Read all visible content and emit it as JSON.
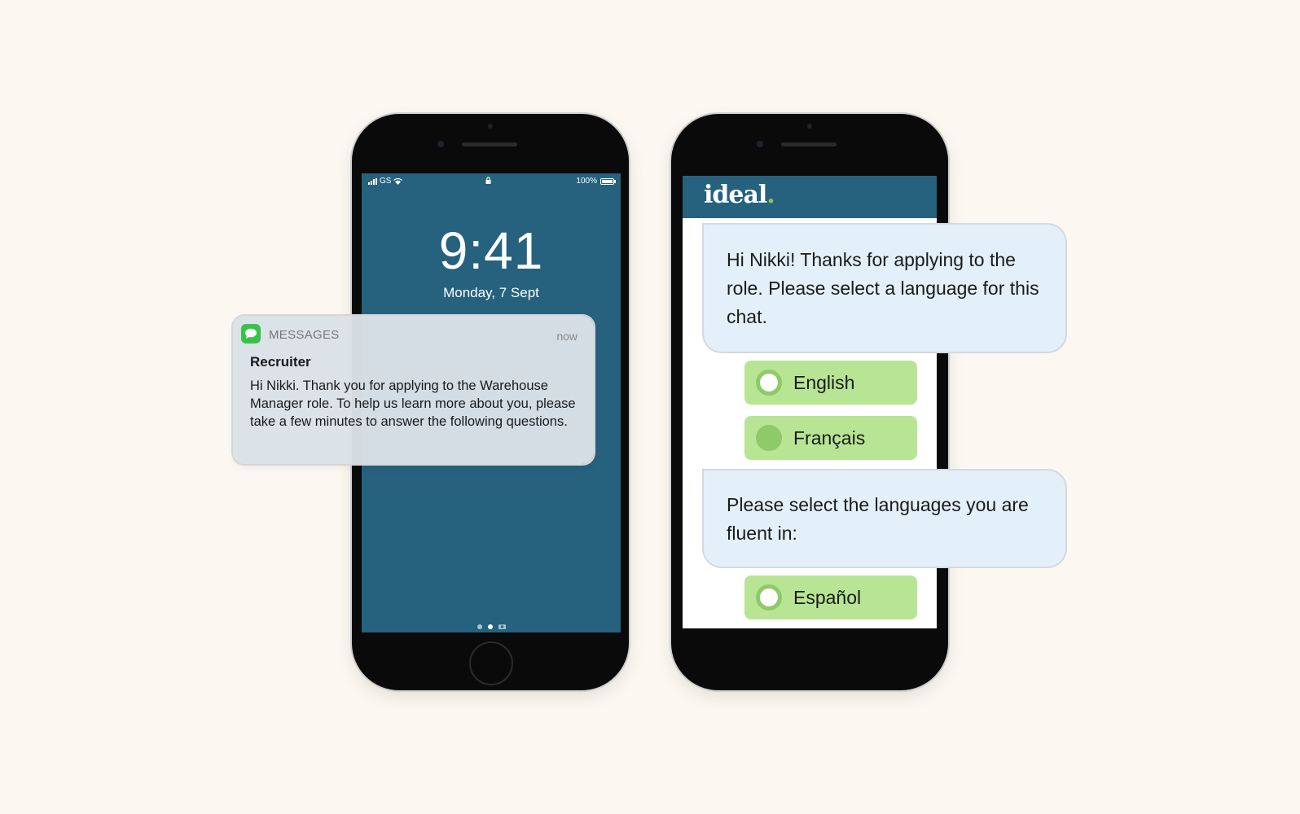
{
  "lock_screen": {
    "status_bar": {
      "carrier": "GS",
      "battery": "100%"
    },
    "time": "9:41",
    "date": "Monday, 7 Sept"
  },
  "notification": {
    "app": "MESSAGES",
    "time": "now",
    "sender": "Recruiter",
    "body": "Hi Nikki. Thank you for applying to the Warehouse Manager role. To help us learn more about you, please take a few minutes to answer the following questions."
  },
  "chat": {
    "brand": "ideal",
    "brand_dot": ".",
    "messages": [
      {
        "text": "Hi Nikki! Thanks for applying to the role. Please select a language for this chat."
      },
      {
        "text": "Please select the languages you are fluent in:"
      }
    ],
    "language_options": [
      {
        "label": "English",
        "selected": false
      },
      {
        "label": "Français",
        "selected": true
      }
    ],
    "fluent_options": [
      {
        "label": "Español",
        "selected": false
      }
    ]
  },
  "colors": {
    "background": "#fcf8f1",
    "screen_blue": "#26617e",
    "bubble": "#e3f0f9",
    "option_green": "#b8e594",
    "brand_dot": "#93c24d"
  }
}
